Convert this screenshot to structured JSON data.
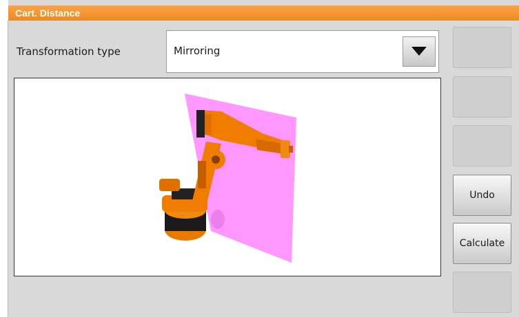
{
  "window": {
    "title": "Cart. Distance"
  },
  "form": {
    "transformation_label": "Transformation type",
    "transformation_value": "Mirroring"
  },
  "buttons": [
    {
      "label": ""
    },
    {
      "label": ""
    },
    {
      "label": ""
    },
    {
      "label": "Undo"
    },
    {
      "label": "Calculate"
    },
    {
      "label": ""
    }
  ],
  "colors": {
    "accent": "#f08a1f",
    "robot": "#f07d00",
    "mirror_plane": "#ff88ff"
  }
}
